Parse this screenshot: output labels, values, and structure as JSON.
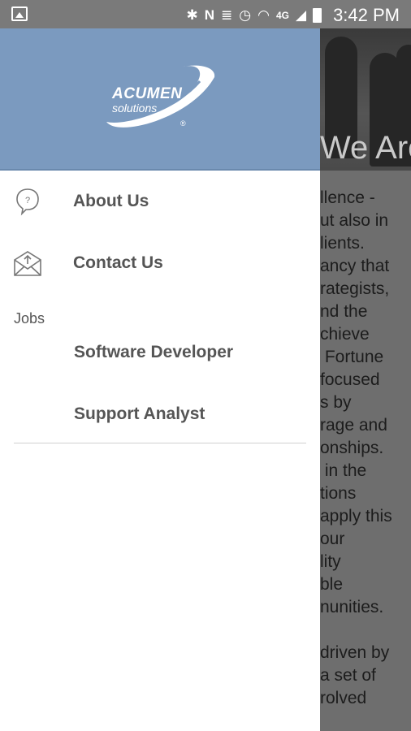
{
  "status_bar": {
    "time": "3:42 PM",
    "icons": [
      "image-icon",
      "bluetooth-icon",
      "nfc-icon",
      "vibrate-icon",
      "alarm-icon",
      "wifi-icon",
      "lte-icon",
      "signal-icon",
      "battery-icon"
    ],
    "network": "4G"
  },
  "drawer": {
    "logo": {
      "brand": "ACUMEN",
      "sub": "solutions",
      "reg": "®"
    },
    "items": [
      {
        "label": "About Us",
        "icon": "help-bubble-icon"
      },
      {
        "label": "Contact Us",
        "icon": "envelope-upload-icon"
      }
    ],
    "section": {
      "label": "Jobs",
      "items": [
        {
          "label": "Software Developer"
        },
        {
          "label": "Support Analyst"
        }
      ]
    }
  },
  "background": {
    "hero_title": "We Are",
    "paragraph_lines": [
      "llence -",
      "ut also in",
      "lients.",
      "ancy that",
      "rategists,",
      "nd the",
      "chieve",
      " Fortune",
      "focused",
      "s by",
      "rage and",
      "onships.",
      " in the",
      "tions",
      "apply this",
      "our",
      "lity",
      "ble",
      "nunities.",
      "",
      "driven by",
      "a set of",
      "rolved"
    ]
  },
  "colors": {
    "header_bg": "#7b9abf",
    "statusbar_bg": "#7a7a7a",
    "overlay": "#6e6e6e",
    "text": "#555555"
  }
}
